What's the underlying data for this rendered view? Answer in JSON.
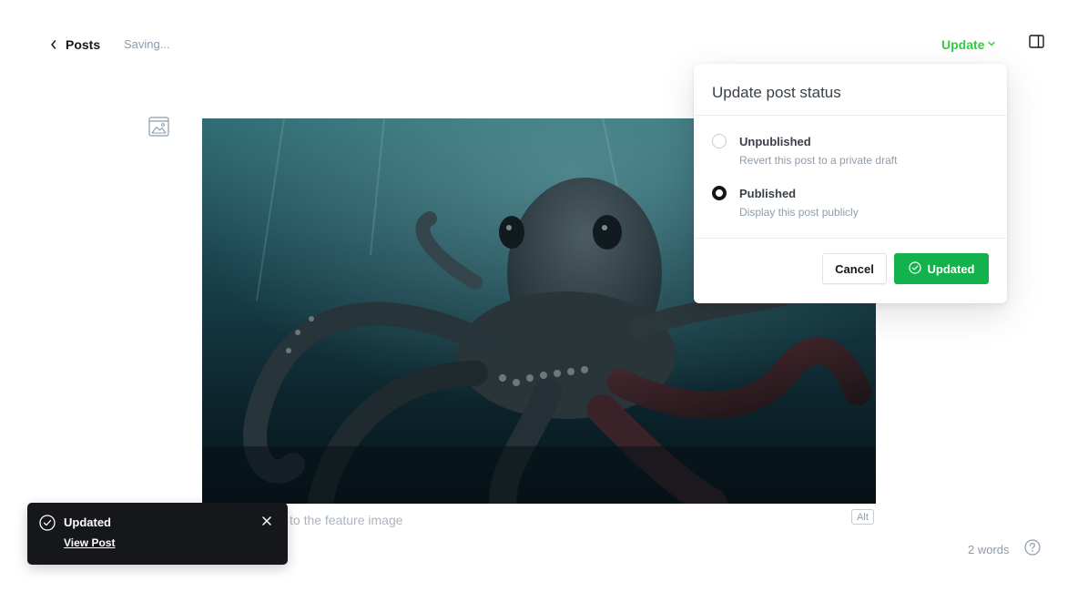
{
  "header": {
    "back_label": "Posts",
    "saving_status": "Saving...",
    "update_label": "Update"
  },
  "editor": {
    "caption_placeholder": "to the feature image",
    "alt_label": "Alt",
    "word_count": "2 words"
  },
  "publish_popover": {
    "title": "Update post status",
    "options": [
      {
        "label": "Unpublished",
        "description": "Revert this post to a private draft",
        "selected": false
      },
      {
        "label": "Published",
        "description": "Display this post publicly",
        "selected": true
      }
    ],
    "cancel_label": "Cancel",
    "confirm_label": "Updated"
  },
  "toast": {
    "title": "Updated",
    "link_label": "View Post"
  },
  "colors": {
    "accent_green": "#30cf43",
    "button_green": "#14b24d",
    "toast_bg": "#15171a"
  },
  "icons": {
    "back": "chevron-left-icon",
    "update_dropdown": "chevron-down-icon",
    "sidebar": "sidebar-toggle-icon",
    "feature_image": "image-icon",
    "help": "question-icon",
    "confirm": "check-circle-icon",
    "toast_status": "check-circle-icon",
    "toast_close": "close-icon"
  }
}
